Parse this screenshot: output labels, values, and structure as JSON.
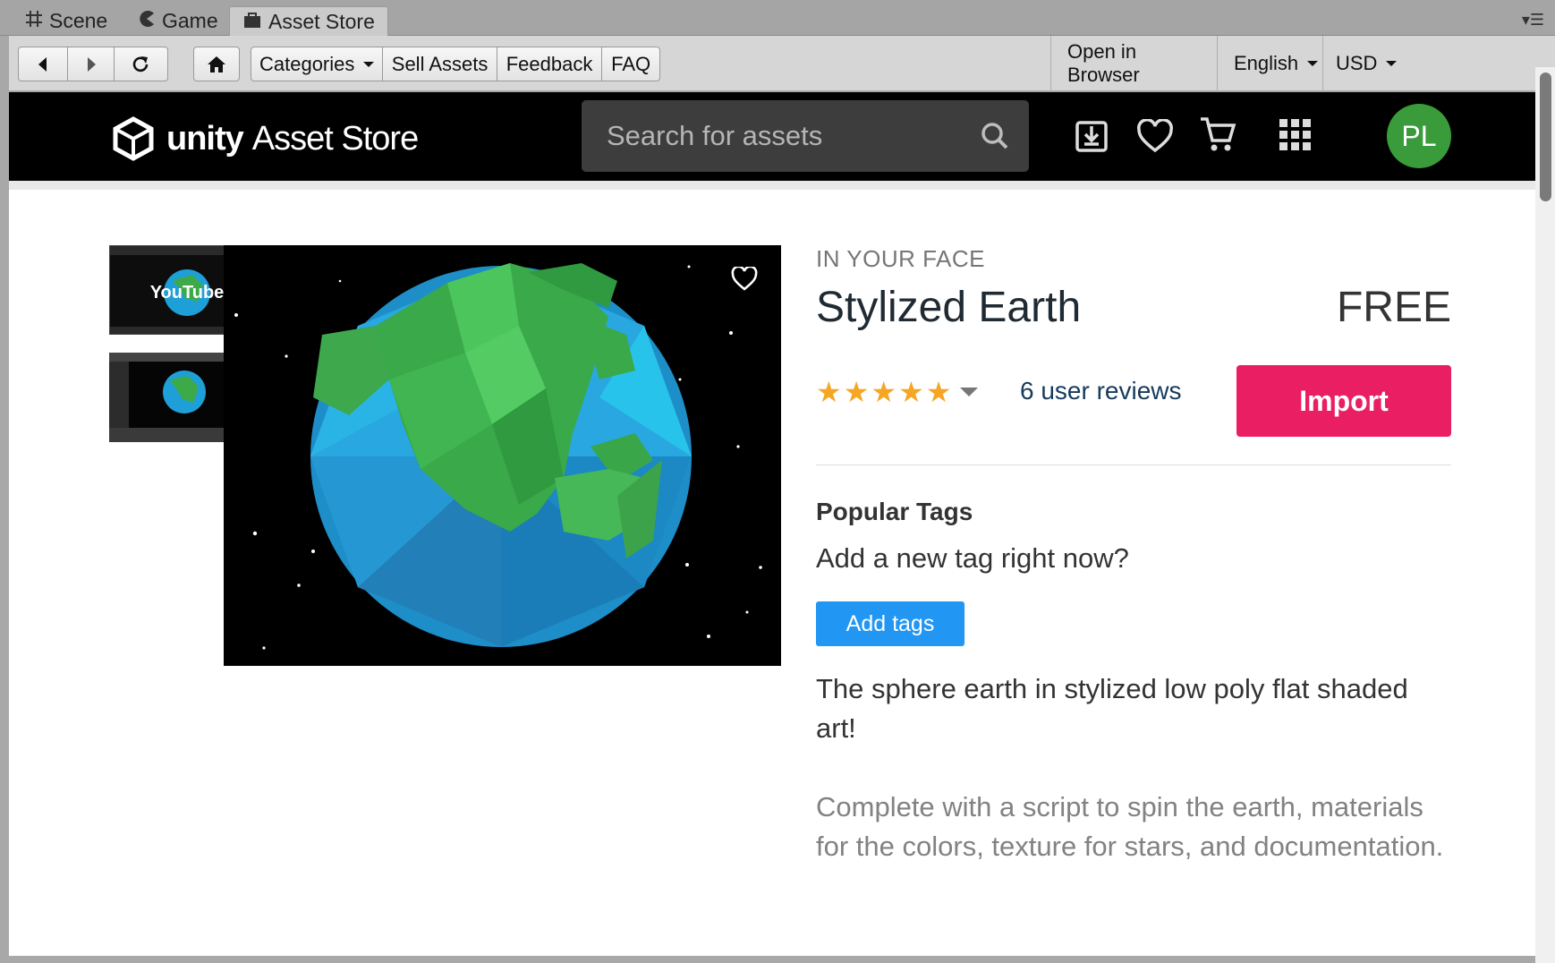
{
  "editor_tabs": [
    {
      "label": "Scene",
      "icon": "grid-icon"
    },
    {
      "label": "Game",
      "icon": "pacman-icon"
    },
    {
      "label": "Asset Store",
      "icon": "shopping-bag-icon"
    }
  ],
  "toolbar": {
    "categories": "Categories",
    "sell_assets": "Sell Assets",
    "feedback": "Feedback",
    "faq": "FAQ",
    "open_in_browser": "Open in Browser",
    "language": "English",
    "currency": "USD"
  },
  "store": {
    "logo_bold": "unity",
    "logo_light": "Asset Store",
    "search_placeholder": "Search for assets",
    "avatar_initials": "PL"
  },
  "product": {
    "publisher": "IN YOUR FACE",
    "title": "Stylized Earth",
    "price": "FREE",
    "rating": 5,
    "reviews": "6 user reviews",
    "import_label": "Import",
    "popular_tags_heading": "Popular Tags",
    "new_tag_prompt": "Add a new tag right now?",
    "add_tags_label": "Add tags",
    "description_1": "The sphere earth in stylized low poly flat shaded art!",
    "description_2": "Complete with a script to spin the earth, materials for the colors, texture for stars, and documentation.",
    "thumbnail_1_logo": "YouTube"
  },
  "colors": {
    "import": "#ea1e63",
    "add_tags": "#2196f3",
    "star": "#f5a623",
    "avatar": "#3a9b3a"
  }
}
